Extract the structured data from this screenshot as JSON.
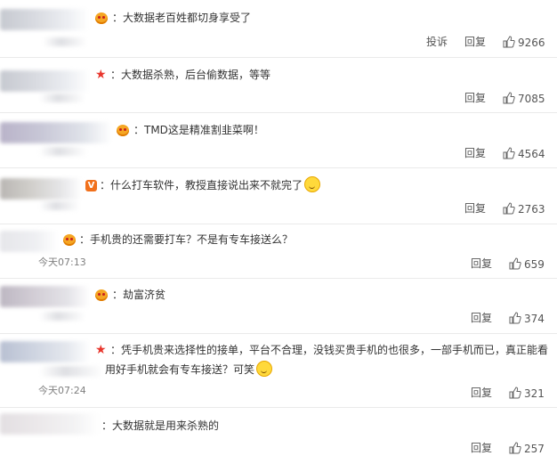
{
  "comments": [
    {
      "text": "：大数据老百姓都切身享受了",
      "time": "",
      "report": "投诉",
      "reply": "回复",
      "likes": "9266"
    },
    {
      "text": "：大数据杀熟，后台偷数据，等等",
      "time": "",
      "reply": "回复",
      "likes": "7085"
    },
    {
      "text": "：TMD这是精准割韭菜啊！",
      "time": "",
      "reply": "回复",
      "likes": "4564"
    },
    {
      "text": "：什么打车软件，教授直接说出来不就完了",
      "time": "",
      "reply": "回复",
      "likes": "2763"
    },
    {
      "text": "：手机贵的还需要打车？不是有专车接送么？",
      "time": "今天07:13",
      "reply": "回复",
      "likes": "659"
    },
    {
      "text": "：劫富济贫",
      "time": "",
      "reply": "回复",
      "likes": "374"
    },
    {
      "text_line1": "：凭手机贵来选择性的接单，平台不合理，没钱买贵手机的也很多，一部手机而已，真正能看",
      "text_line2": "用好手机就会有专车接送？可笑",
      "time": "今天07:24",
      "reply": "回复",
      "likes": "321"
    },
    {
      "text": "：大数据就是用来杀熟的",
      "time": "",
      "reply": "回复",
      "likes": "257"
    }
  ],
  "icons": {
    "thumb": "thumb-up-icon",
    "crown": "crown-badge-icon",
    "star": "star-badge-icon",
    "vip": "vip-badge-icon",
    "emoji": "emoji-icon"
  },
  "colors": {
    "text": "#333333",
    "meta": "#808080",
    "divider": "#eaeaea",
    "badge": "#f5a623",
    "star": "#e8352c",
    "vip": "#f1701b"
  }
}
